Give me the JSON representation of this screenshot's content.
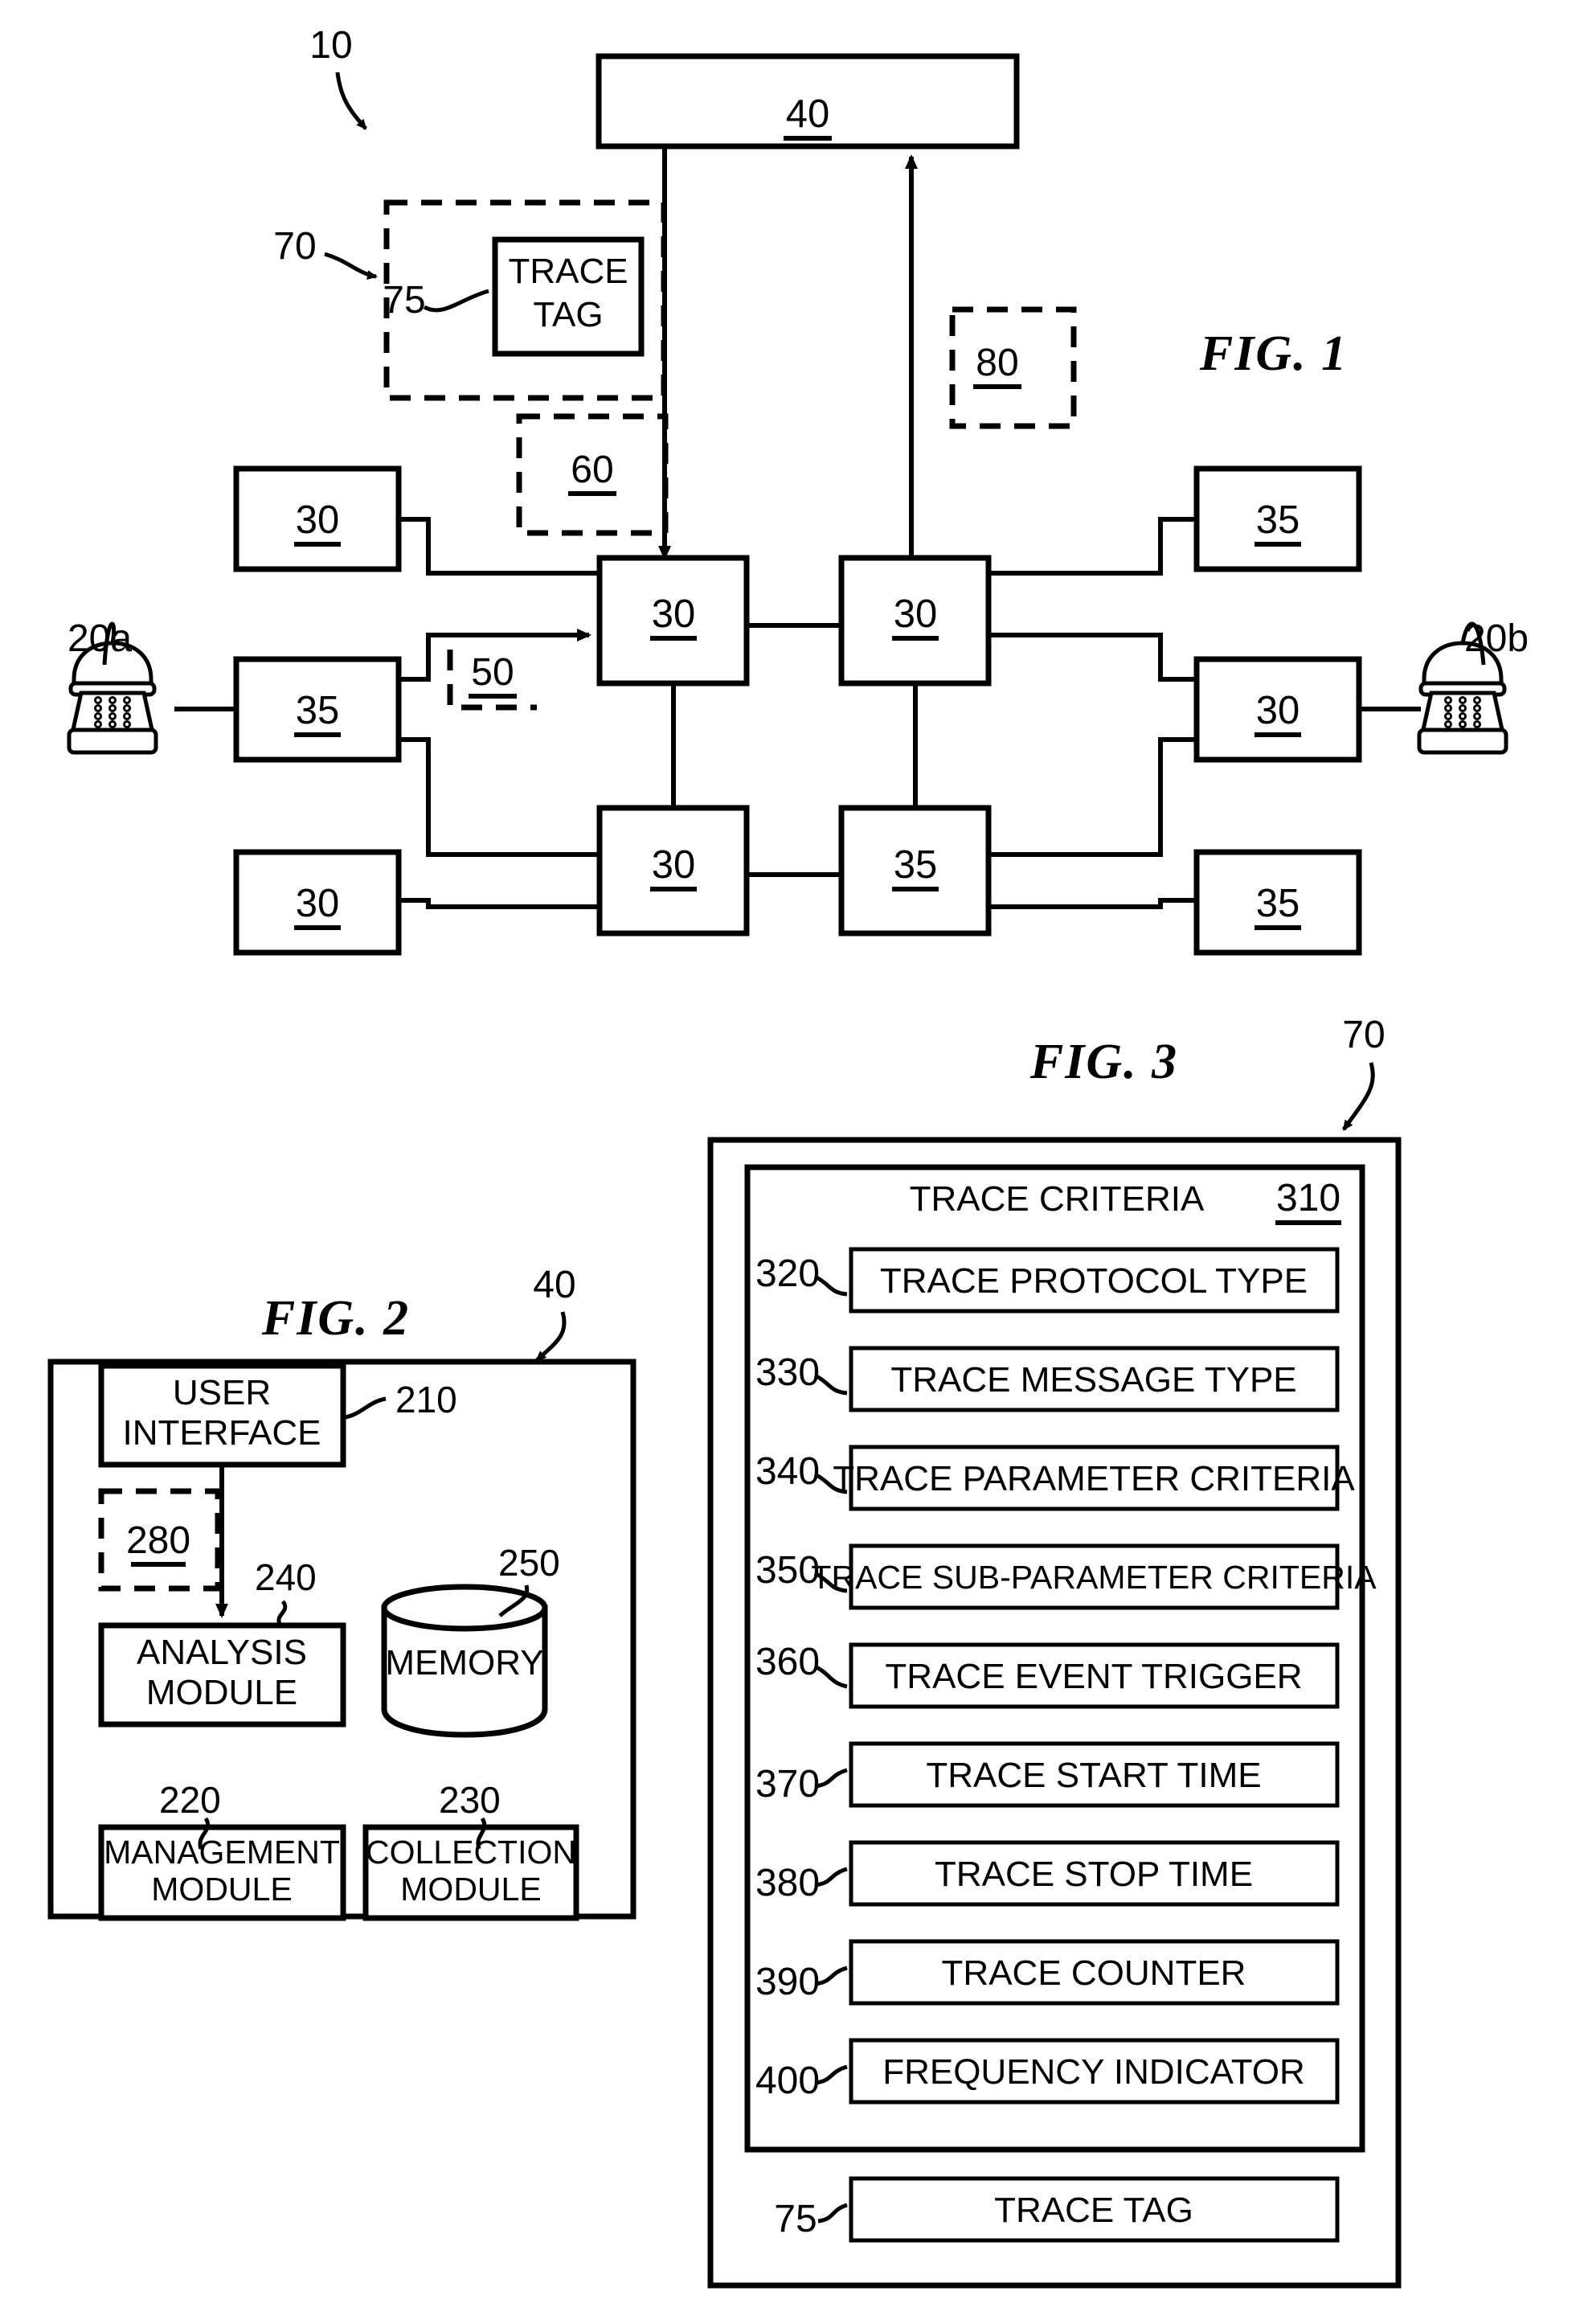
{
  "figures": {
    "fig1": {
      "title": "FIG. 1",
      "system_ref": "10",
      "manager_box": "40",
      "trace_tag_box": "TRACE TAG",
      "refs": {
        "r10": "10",
        "r70": "70",
        "r75": "75",
        "r80": "80",
        "r60": "60",
        "r50": "50",
        "r20a": "20a",
        "r20b": "20b"
      },
      "nodes": [
        {
          "id": "n-left-top",
          "label": "30"
        },
        {
          "id": "n-left-mid",
          "label": "35"
        },
        {
          "id": "n-left-bot",
          "label": "30"
        },
        {
          "id": "n-core-tl",
          "label": "30"
        },
        {
          "id": "n-core-tr",
          "label": "30"
        },
        {
          "id": "n-core-bl",
          "label": "30"
        },
        {
          "id": "n-core-br",
          "label": "35"
        },
        {
          "id": "n-right-top",
          "label": "35"
        },
        {
          "id": "n-right-mid",
          "label": "30"
        },
        {
          "id": "n-right-bot",
          "label": "35"
        }
      ]
    },
    "fig2": {
      "title": "FIG. 2",
      "outer_ref": "40",
      "blocks": [
        {
          "label_line1": "USER",
          "label_line2": "INTERFACE",
          "ref": "210"
        },
        {
          "label_line1": "ANALYSIS",
          "label_line2": "MODULE",
          "ref": "240"
        },
        {
          "label_line1": "MEMORY",
          "label_line2": "",
          "ref": "250"
        },
        {
          "label_line1": "MANAGEMENT",
          "label_line2": "MODULE",
          "ref": "220"
        },
        {
          "label_line1": "COLLECTION",
          "label_line2": "MODULE",
          "ref": "230"
        }
      ],
      "dashed_ref": "280"
    },
    "fig3": {
      "title": "FIG. 3",
      "outer_ref": "70",
      "criteria_heading": "TRACE CRITERIA",
      "criteria_heading_ref": "310",
      "criteria_items": [
        {
          "ref": "320",
          "label": "TRACE PROTOCOL TYPE"
        },
        {
          "ref": "330",
          "label": "TRACE MESSAGE TYPE"
        },
        {
          "ref": "340",
          "label": "TRACE PARAMETER CRITERIA"
        },
        {
          "ref": "350",
          "label": "TRACE SUB-PARAMETER CRITERIA"
        },
        {
          "ref": "360",
          "label": "TRACE EVENT TRIGGER"
        },
        {
          "ref": "370",
          "label": "TRACE START TIME"
        },
        {
          "ref": "380",
          "label": "TRACE STOP TIME"
        },
        {
          "ref": "390",
          "label": "TRACE COUNTER"
        },
        {
          "ref": "400",
          "label": "FREQUENCY INDICATOR"
        }
      ],
      "trace_tag": {
        "ref": "75",
        "label": "TRACE TAG"
      }
    }
  }
}
